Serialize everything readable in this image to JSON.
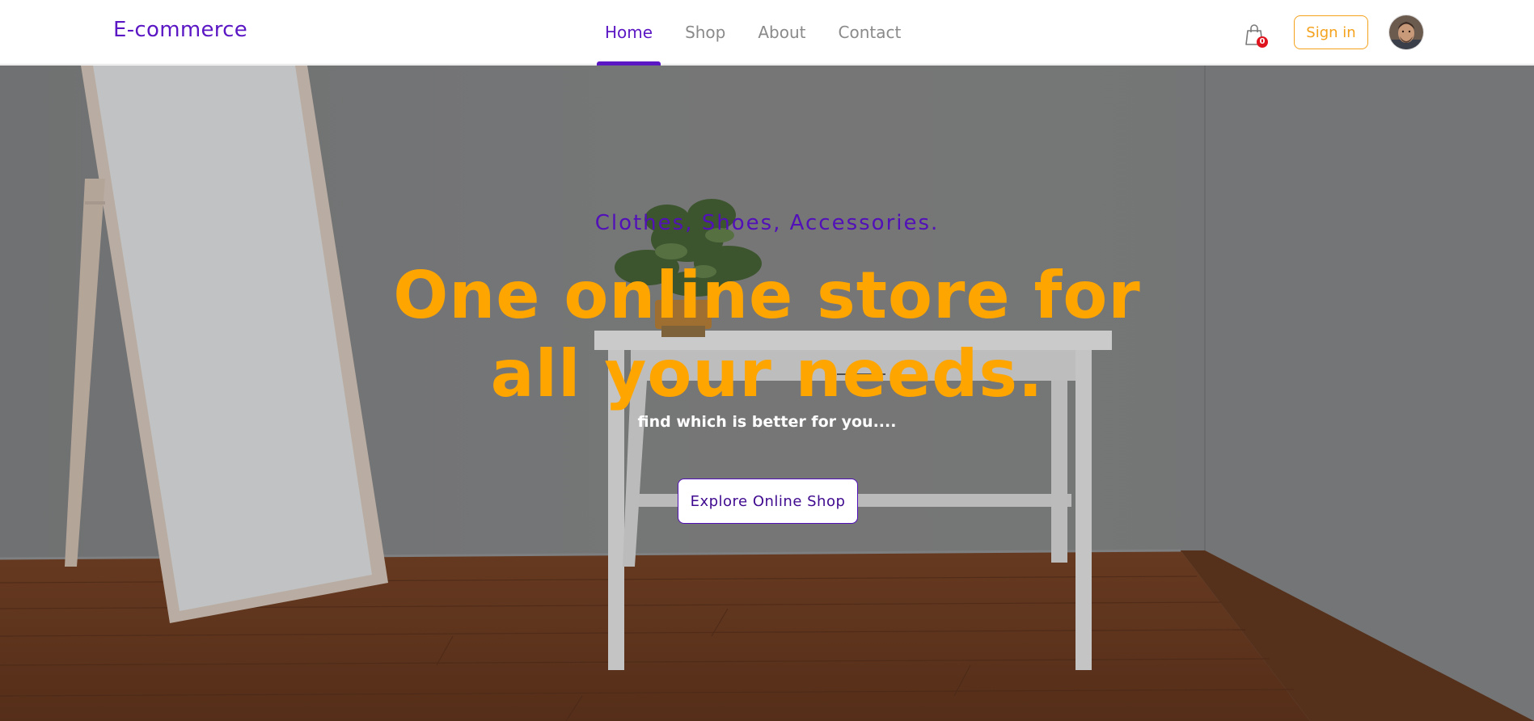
{
  "navbar": {
    "brand": "E-commerce",
    "links": [
      {
        "label": "Home",
        "active": true
      },
      {
        "label": "Shop",
        "active": false
      },
      {
        "label": "About",
        "active": false
      },
      {
        "label": "Contact",
        "active": false
      }
    ],
    "cart_count": "0",
    "signin_label": "Sign in",
    "cart_icon": "shopping-bag-icon",
    "avatar": "user-avatar"
  },
  "hero": {
    "tagline": "Clothes, Shoes, Accessories.",
    "headline": "One online store for all your needs.",
    "subtitle": "find which is better for you....",
    "cta_label": "Explore Online Shop"
  },
  "colors": {
    "accent_purple": "#5b17c4",
    "accent_orange": "#ffa500",
    "badge_red": "#e0141e"
  }
}
